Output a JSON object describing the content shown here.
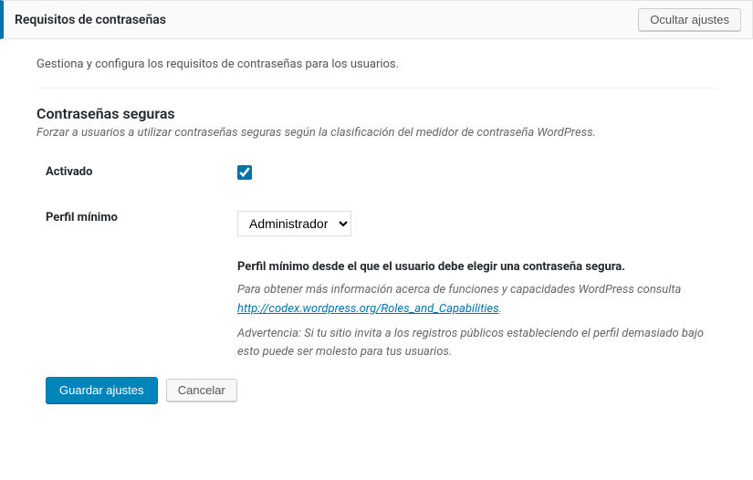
{
  "header": {
    "title": "Requisitos de contraseñas",
    "hide_button": "Ocultar ajustes"
  },
  "intro": "Gestiona y configura los requisitos de contraseñas para los usuarios.",
  "section": {
    "title": "Contraseñas seguras",
    "description": "Forzar a usuarios a utilizar contraseñas seguras según la clasificación del medidor de contraseña WordPress."
  },
  "fields": {
    "activado": {
      "label": "Activado",
      "checked": true
    },
    "perfil_minimo": {
      "label": "Perfil mínimo",
      "selected": "Administrador",
      "heading": "Perfil mínimo desde el que el usuario debe elegir una contraseña segura.",
      "help1_pre": "Para obtener más información acerca de funciones y capacidades WordPress consulta ",
      "help1_link_text": "http://codex.wordpress.org/Roles_and_Capabilities",
      "help1_link_href": "http://codex.wordpress.org/Roles_and_Capabilities",
      "help1_post": ".",
      "help2": "Advertencia: Si tu sitio invita a los registros públicos estableciendo el perfil demasiado bajo esto puede ser molesto para tus usuarios."
    }
  },
  "actions": {
    "save": "Guardar ajustes",
    "cancel": "Cancelar"
  }
}
